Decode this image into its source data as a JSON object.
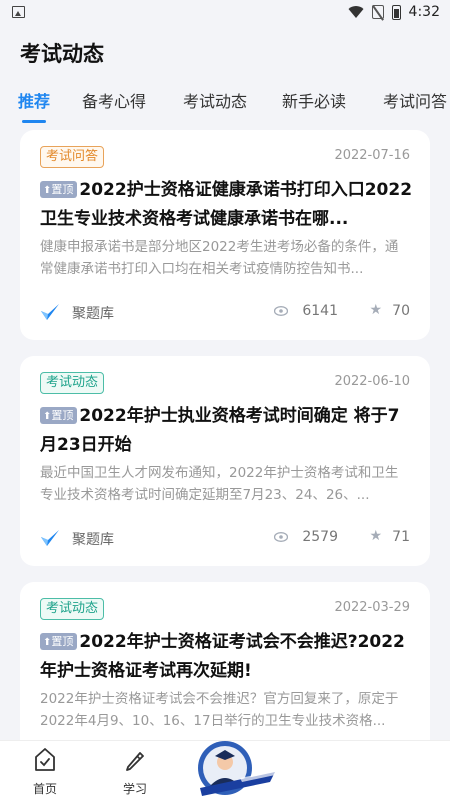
{
  "status_bar": {
    "time": "4:32"
  },
  "header": {
    "title": "考试动态"
  },
  "tabs": [
    {
      "label": "推荐"
    },
    {
      "label": "备考心得"
    },
    {
      "label": "考试动态"
    },
    {
      "label": "新手必读"
    },
    {
      "label": "考试问答"
    }
  ],
  "pin_label": "置顶",
  "articles": [
    {
      "category": "考试问答",
      "date": "2022-07-16",
      "title": "2022护士资格证健康承诺书打印入口2022卫生专业技术资格考试健康承诺书在哪...",
      "summary": "健康申报承诺书是部分地区2022考生进考场必备的条件，通常健康承诺书打印入口均在相关考试疫情防控告知书...",
      "source": "聚题库",
      "views": "6141",
      "stars": "70"
    },
    {
      "category": "考试动态",
      "date": "2022-06-10",
      "title": "2022年护士执业资格考试时间确定 将于7月23日开始",
      "summary": "最近中国卫生人才网发布通知，2022年护士资格考试和卫生专业技术资格考试时间确定延期至7月23、24、26、...",
      "source": "聚题库",
      "views": "2579",
      "stars": "71"
    },
    {
      "category": "考试动态",
      "date": "2022-03-29",
      "title": "2022年护士资格证考试会不会推迟?2022年护士资格证考试再次延期!",
      "summary": "2022年护士资格证考试会不会推迟？官方回复来了，原定于2022年4月9、10、16、17日举行的卫生专业技术资格...",
      "source": "",
      "views": "",
      "stars": ""
    }
  ],
  "bottom_nav": [
    {
      "label": "首页"
    },
    {
      "label": "学习"
    }
  ],
  "colors": {
    "accent": "#1f86f0",
    "orange_badge": "#e38a2c",
    "teal_badge": "#1ea38b"
  },
  "icons": [
    "image-icon",
    "wifi-icon",
    "no-sim-icon",
    "battery-icon",
    "eye-icon",
    "star-icon",
    "home-icon",
    "study-icon"
  ]
}
